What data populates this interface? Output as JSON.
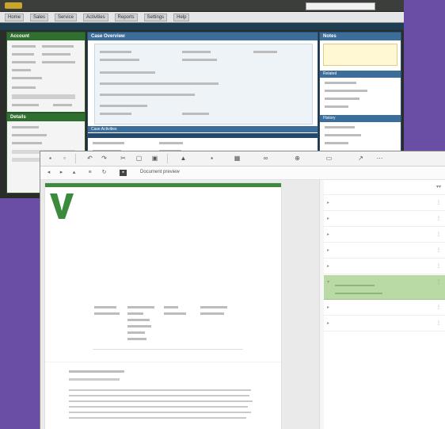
{
  "back_window": {
    "nav_items": [
      "Home",
      "Sales",
      "Service",
      "Activities",
      "Reports",
      "Settings",
      "Help"
    ],
    "panels": {
      "left_top_title": "Account",
      "left_bottom_title": "Details",
      "center_title": "Case Overview",
      "center_subtitle": "Case Activities",
      "right_title": "Notes",
      "right_sub1": "Related",
      "right_sub2": "History"
    }
  },
  "front_window": {
    "toolbar": {
      "path_text": "Document preview"
    },
    "document": {
      "brand_line1": "",
      "brand_line2": "",
      "date": "",
      "addr1": "",
      "addr2": ""
    },
    "sidebar": {
      "header_label": "",
      "items": [
        {
          "label": "",
          "selected": false
        },
        {
          "label": "",
          "selected": false
        },
        {
          "label": "",
          "selected": false
        },
        {
          "label": "",
          "selected": false
        },
        {
          "label": "",
          "selected": false
        },
        {
          "label": "",
          "selected": true
        },
        {
          "label": "",
          "selected": false
        },
        {
          "label": "",
          "selected": false
        }
      ]
    }
  },
  "colors": {
    "desktop": "#6a4ea5",
    "brand_green": "#3c8a3c",
    "selected_row": "#b9d9a5",
    "crm_blue": "#3c6e9c"
  },
  "icons": [
    "v-logo-icon",
    "chevron-right-icon",
    "chevron-down-icon",
    "more-icon"
  ]
}
